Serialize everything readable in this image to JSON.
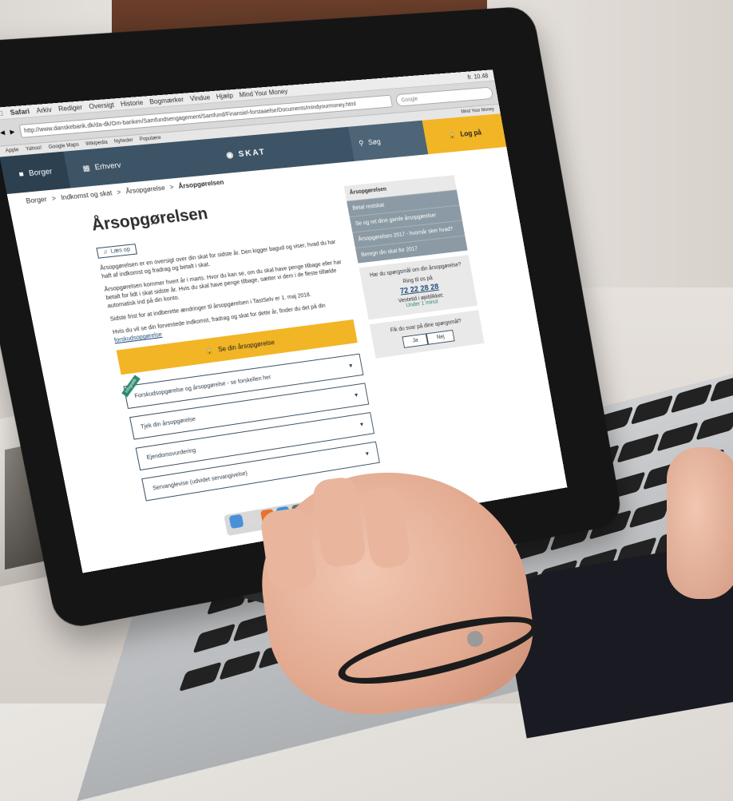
{
  "mac_menubar": {
    "app": "Safari",
    "items": [
      "Arkiv",
      "Rediger",
      "Oversigt",
      "Historie",
      "Bogmærker",
      "Vindue",
      "Hjælp"
    ],
    "window_title": "Mind Your Money",
    "clock": "fr. 10.48"
  },
  "browser": {
    "url": "http://www.danskebank.dk/da-dk/Om-banken/Samfundsengagement/Samfund/Finansiel-forstaaelse/Documents/mindyourmoney.html",
    "search_placeholder": "Google",
    "bookmarks": [
      "Apple",
      "Yahoo!",
      "Google Maps",
      "Wikipedia",
      "Nyheder",
      "Populære"
    ],
    "tab_label": "Mind Your Money"
  },
  "site_header": {
    "tab_citizen": "Borger",
    "tab_business": "Erhverv",
    "logo_text": "SKAT",
    "search_label": "Søg",
    "login_label": "Log på"
  },
  "breadcrumb": [
    "Borger",
    "Indkomst og skat",
    "Årsopgørelse",
    "Årsopgørelsen"
  ],
  "main": {
    "title": "Årsopgørelsen",
    "read_aloud": "Læs op",
    "paragraphs": [
      "Årsopgørelsen er en oversigt over din skat for sidste år. Den kigger bagud og viser, hvad du har haft af indkomst og fradrag og betalt i skat.",
      "Årsopgørelsen kommer hvert år i marts. Hvor du kan se, om du skal have penge tilbage eller har betalt for lidt i skat sidste år. Hvis du skal have penge tilbage, sætter vi dem i de fleste tilfælde automatisk ind på din konto.",
      "Sidste frist for at indberette ændringer til årsopgørelsen i TastSelv er 1. maj 2018."
    ],
    "link_paragraph_prefix": "Hvis du vil se din forventede indkomst, fradrag og skat for dette år, finder du det på din",
    "link_text": "forskudsopgørelse",
    "cta_label": "Se din årsopgørelse",
    "accordions": [
      {
        "label": "Forskudsopgørelse og årsopgørelse - se forskellen her",
        "ribbon": "infografik"
      },
      {
        "label": "Tjek din årsopgørelse",
        "ribbon": ""
      },
      {
        "label": "Ejendomsvurdering",
        "ribbon": ""
      },
      {
        "label": "Servanglevise (udvidet servangivelse)",
        "ribbon": ""
      }
    ]
  },
  "sidebar": {
    "heading": "Årsopgørelsen",
    "links": [
      "Betal restskat",
      "Se og ret dine gamle årsopgørelser",
      "Årsopgørelsen 2017 - hvornår sker hvad?",
      "Beregn din skat for 2017"
    ],
    "help_question": "Har du spørgsmål om din årsopgørelse?",
    "call_label": "Ring til os på",
    "phone": "72 22 28 28",
    "wait_label": "Ventetid i øjeblikket:",
    "wait_value": "Under 1 minut",
    "feedback_question": "Fik du svar på dine spørgsmål?",
    "yes": "Ja",
    "no": "Nej"
  },
  "colors": {
    "header_bg": "#3d5466",
    "accent_yellow": "#f2b526",
    "sidebar_link_bg": "#8b9aa4",
    "wait_green": "#2c8a6e"
  },
  "icons": [
    "user-icon",
    "business-icon",
    "skat-logo-icon",
    "search-icon",
    "lock-icon",
    "chevron-down-icon",
    "speaker-icon"
  ]
}
